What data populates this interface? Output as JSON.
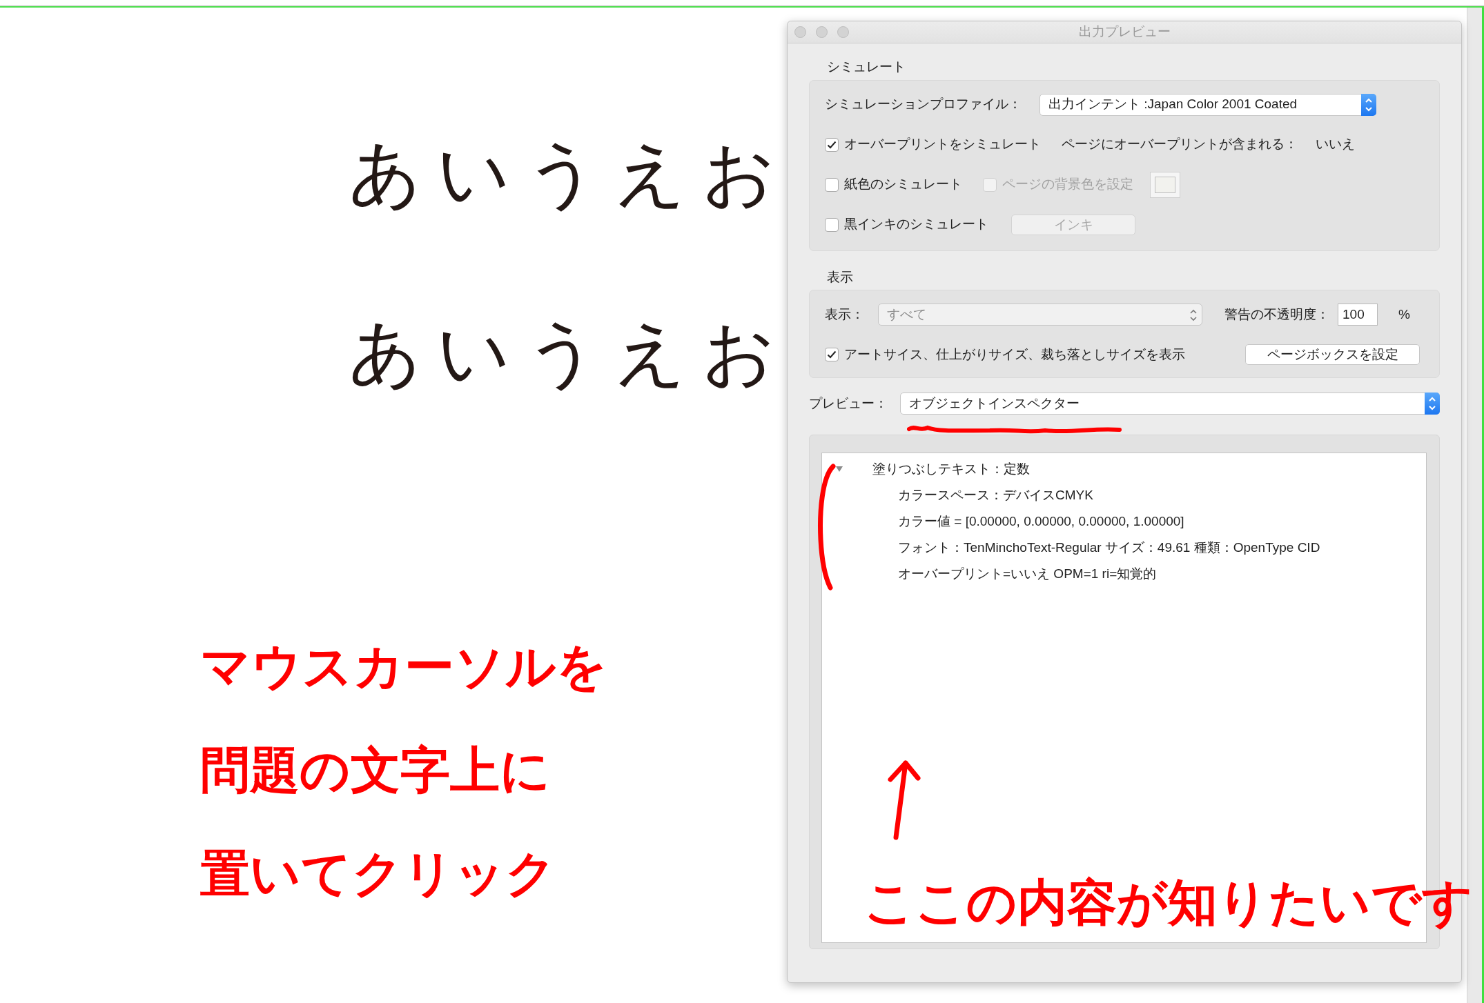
{
  "canvas": {
    "texts": [
      "あいうえお",
      "あいうえお"
    ]
  },
  "dialog": {
    "title": "出力プレビュー",
    "simulate": {
      "heading": "シミュレート",
      "profile": {
        "label": "シミュレーションプロファイル：",
        "value": "出力インテント :Japan Color 2001 Coated"
      },
      "overprint": {
        "label": "オーバープリントをシミュレート",
        "checked": true,
        "info_label": "ページにオーバープリントが含まれる：",
        "info_value": "いいえ"
      },
      "paper": {
        "label": "紙色のシミュレート",
        "checked": false,
        "background": {
          "label": "ページの背景色を設定",
          "checked": false,
          "disabled": true
        }
      },
      "black_ink": {
        "label": "黒インキのシミュレート",
        "checked": false,
        "button": {
          "label": "インキ",
          "disabled": true
        }
      }
    },
    "display": {
      "heading": "表示",
      "show": {
        "label": "表示：",
        "value": "すべて",
        "disabled": true
      },
      "opacity": {
        "label": "警告の不透明度：",
        "value": "100",
        "unit": "%"
      },
      "sizes": {
        "label": "アートサイス、仕上がりサイズ、裁ち落としサイズを表示",
        "checked": true
      },
      "page_box_button": "ページボックスを設定"
    },
    "preview": {
      "label": "プレビュー：",
      "value": "オブジェクトインスペクター"
    },
    "inspector": {
      "tree": [
        {
          "label": "塗りつぶしテキスト：定数",
          "expanded": true,
          "children": [
            {
              "label": "カラースペース：デバイスCMYK"
            },
            {
              "label": "カラー値 = [0.00000, 0.00000, 0.00000, 1.00000]"
            },
            {
              "label": "フォント：TenMinchoText-Regular サイズ：49.61 種類：OpenType CID"
            },
            {
              "label": "オーバープリント=いいえ OPM=1 ri=知覚的"
            }
          ]
        }
      ]
    }
  },
  "annotations": {
    "left_notes": [
      "マウスカーソルを",
      "問題の文字上に",
      "置いてクリック"
    ],
    "right_note": "ここの内容が知りたいです"
  }
}
